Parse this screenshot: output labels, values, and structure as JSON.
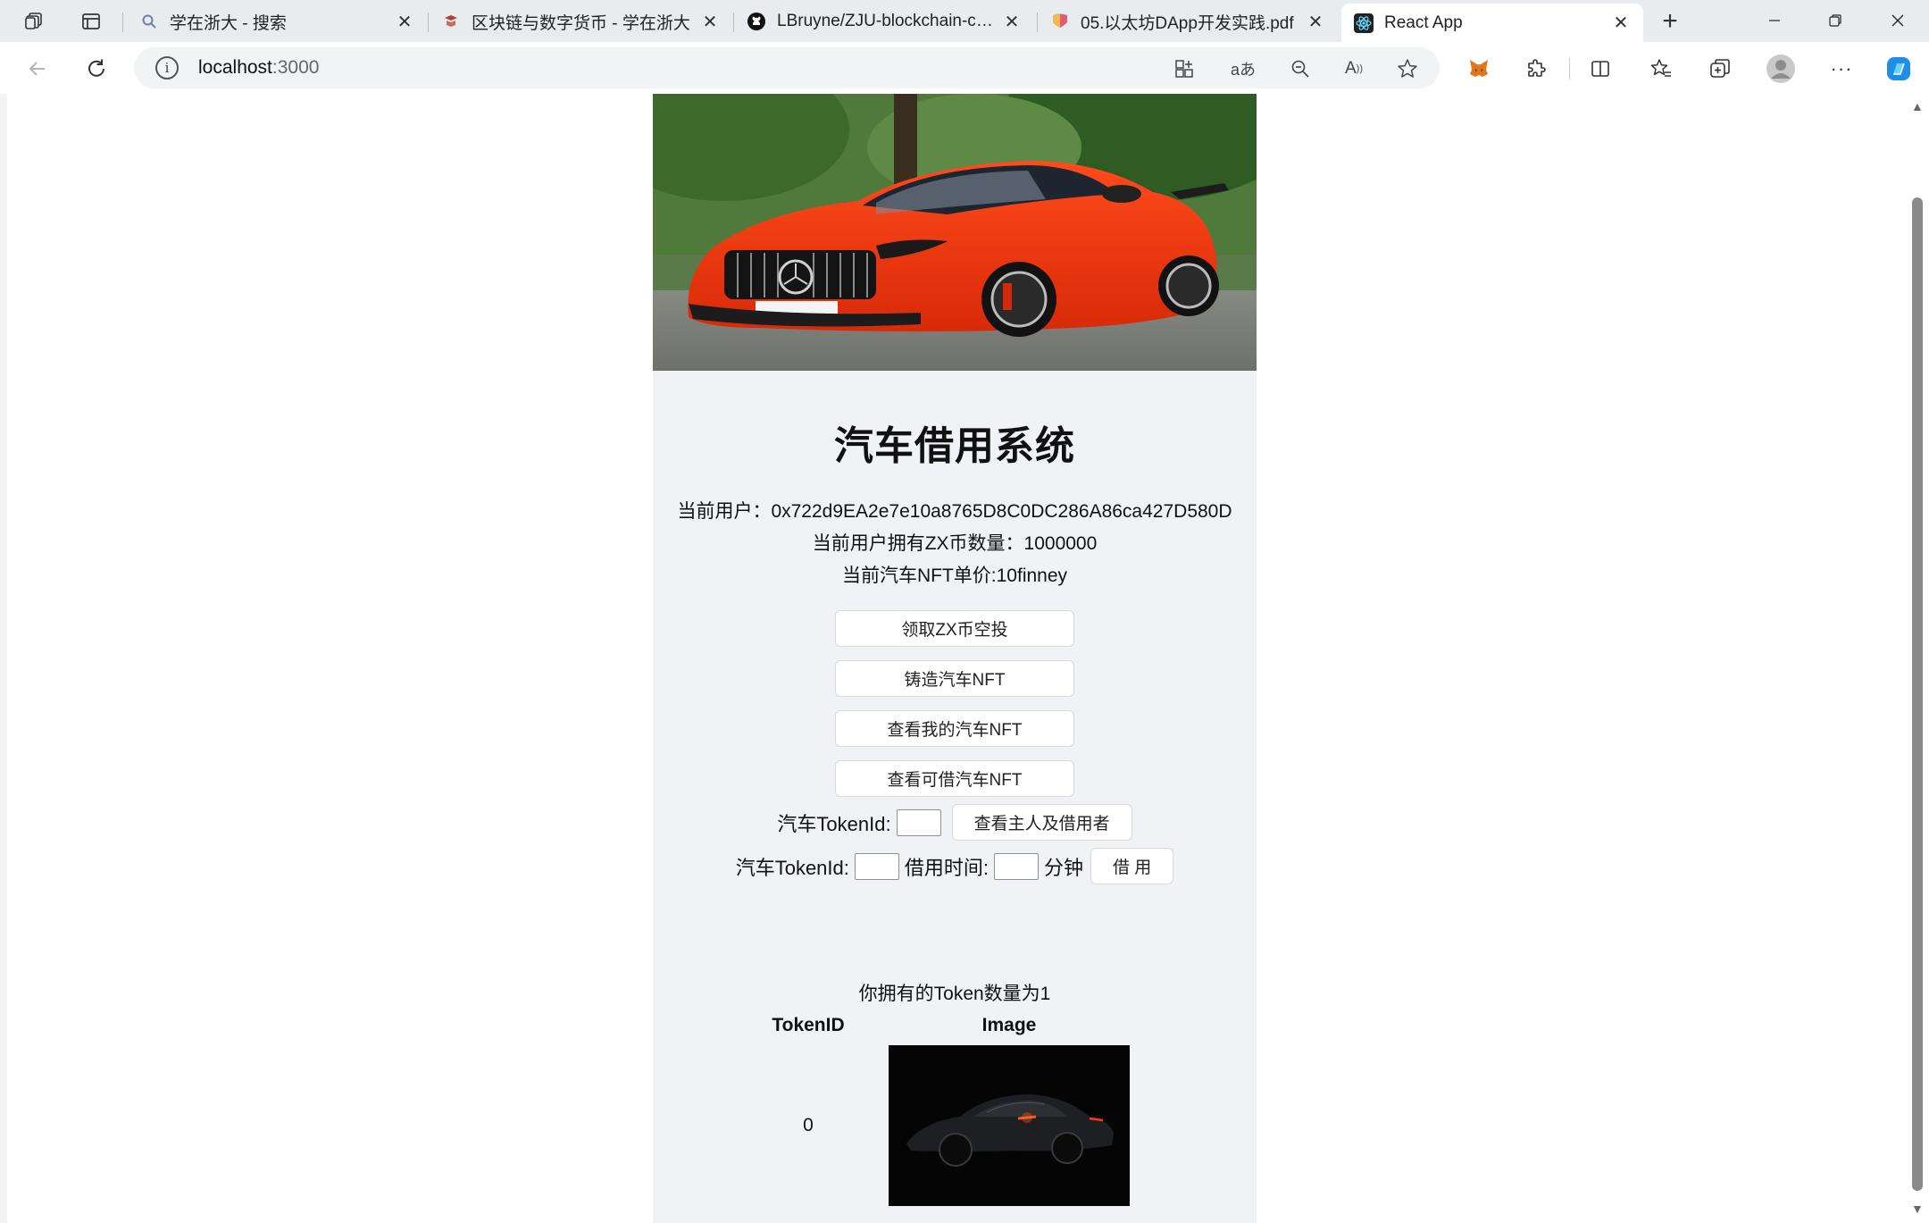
{
  "browser": {
    "tabs": [
      {
        "label": "学在浙大 - 搜索",
        "icon": "search-icon"
      },
      {
        "label": "区块链与数字货币 - 学在浙大",
        "icon": "course-icon"
      },
      {
        "label": "LBruyne/ZJU-blockchain-course",
        "icon": "github-icon"
      },
      {
        "label": "05.以太坊DApp开发实践.pdf",
        "icon": "pdf-icon"
      },
      {
        "label": "React App",
        "icon": "react-icon"
      }
    ],
    "active_tab_index": 4,
    "url_host": "localhost",
    "url_port": ":3000"
  },
  "app": {
    "title": "汽车借用系统",
    "current_user": "当前用户：0x722d9EA2e7e10a8765D8C0DC286A86ca427D580D",
    "zx_balance": "当前用户拥有ZX币数量：1000000",
    "nft_price": "当前汽车NFT单价:10finney",
    "buttons": {
      "airdrop": "领取ZX币空投",
      "mint": "铸造汽车NFT",
      "my_nfts": "查看我的汽车NFT",
      "available_nfts": "查看可借汽车NFT",
      "query_owner": "查看主人及借用者",
      "borrow": "借 用"
    },
    "form": {
      "token_id_label": "汽车TokenId:",
      "borrow_time_label": "借用时间:",
      "minutes_label": "分钟"
    },
    "token_count_text": "你拥有的Token数量为1",
    "table": {
      "headers": [
        "TokenID",
        "Image"
      ],
      "rows": [
        {
          "token_id": "0"
        }
      ]
    }
  }
}
